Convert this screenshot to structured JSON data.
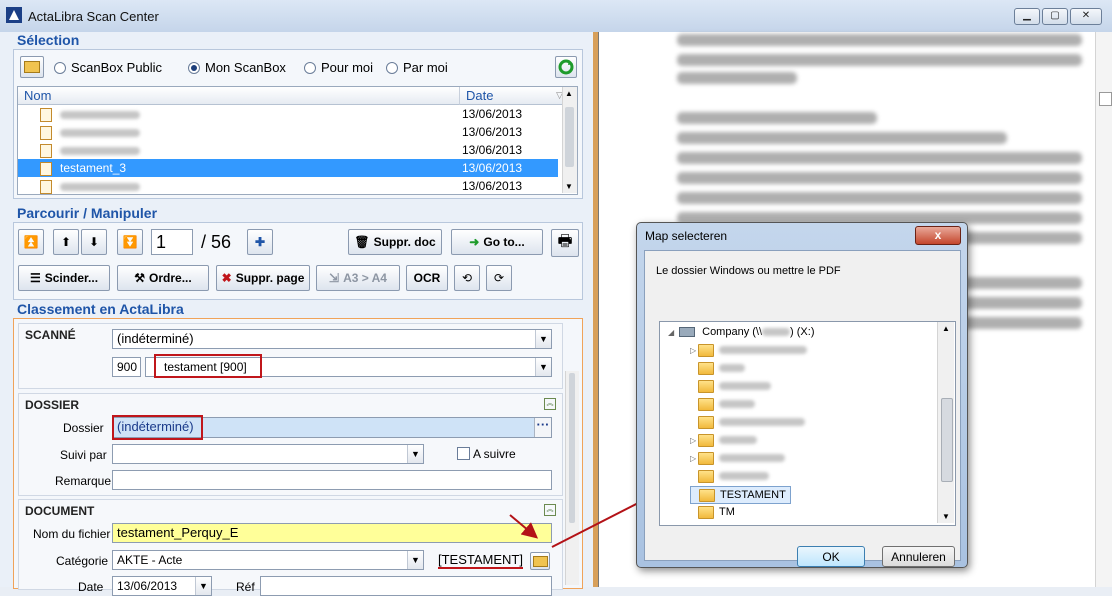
{
  "window": {
    "title": "ActaLibra Scan Center",
    "min": "▁",
    "max": "▢",
    "close": "✕"
  },
  "selection": {
    "heading": "Sélection",
    "radios": [
      {
        "label": "ScanBox Public",
        "selected": false
      },
      {
        "label": "Mon ScanBox",
        "selected": true
      },
      {
        "label": "Pour moi",
        "selected": false
      },
      {
        "label": "Par moi",
        "selected": false
      }
    ],
    "columns": {
      "name": "Nom",
      "date": "Date"
    },
    "rows": [
      {
        "name": "",
        "date": "13/06/2013",
        "selected": false
      },
      {
        "name": "",
        "date": "13/06/2013",
        "selected": false
      },
      {
        "name": "",
        "date": "13/06/2013",
        "selected": false
      },
      {
        "name": "testament_3",
        "date": "13/06/2013",
        "selected": true
      },
      {
        "name": "",
        "date": "13/06/2013",
        "selected": false
      }
    ]
  },
  "browse": {
    "heading": "Parcourir / Manipuler",
    "page": "1",
    "total": "/ 56",
    "suppr_doc": "Suppr. doc",
    "goto": "Go to...",
    "scinder": "Scinder...",
    "ordre": "Ordre...",
    "suppr_page": "Suppr. page",
    "a3a4": "A3 > A4",
    "ocr": "OCR"
  },
  "classement": {
    "heading": "Classement en ActaLibra",
    "scanne": {
      "label": "SCANNÉ",
      "value1": "(indéterminé)",
      "code": "900",
      "value2": "testament [900]"
    },
    "dossier": {
      "label": "DOSSIER",
      "dossier_label": "Dossier",
      "dossier_value": "(indéterminé)",
      "suivi_label": "Suivi par",
      "suivi_value": "",
      "asuivre": "A suivre",
      "remarque_label": "Remarque"
    },
    "document": {
      "label": "DOCUMENT",
      "nom_label": "Nom du fichier",
      "nom_value": "testament_Perquy_E",
      "cat_label": "Catégorie",
      "cat_value": "AKTE - Acte",
      "tag": "[TESTAMENT]",
      "date_label": "Date",
      "date_value": "13/06/2013",
      "ref_label": "Réf"
    }
  },
  "dialog": {
    "title": "Map selecteren",
    "close": "x",
    "instruction": "Le dossier Windows ou mettre le PDF",
    "root": "Company (\\\\",
    "root_suffix": ") (X:)",
    "folders": [
      "",
      "",
      "",
      "",
      "",
      "",
      "",
      "",
      "",
      "TESTAMENT",
      "TM"
    ],
    "ok": "OK",
    "cancel": "Annuleren"
  },
  "colors": {
    "accent": "#1f55a8",
    "selection": "#3399ff",
    "highlight_yellow": "#ffff99",
    "dossier_blue": "#cfe3f7",
    "red": "#c0161b"
  }
}
